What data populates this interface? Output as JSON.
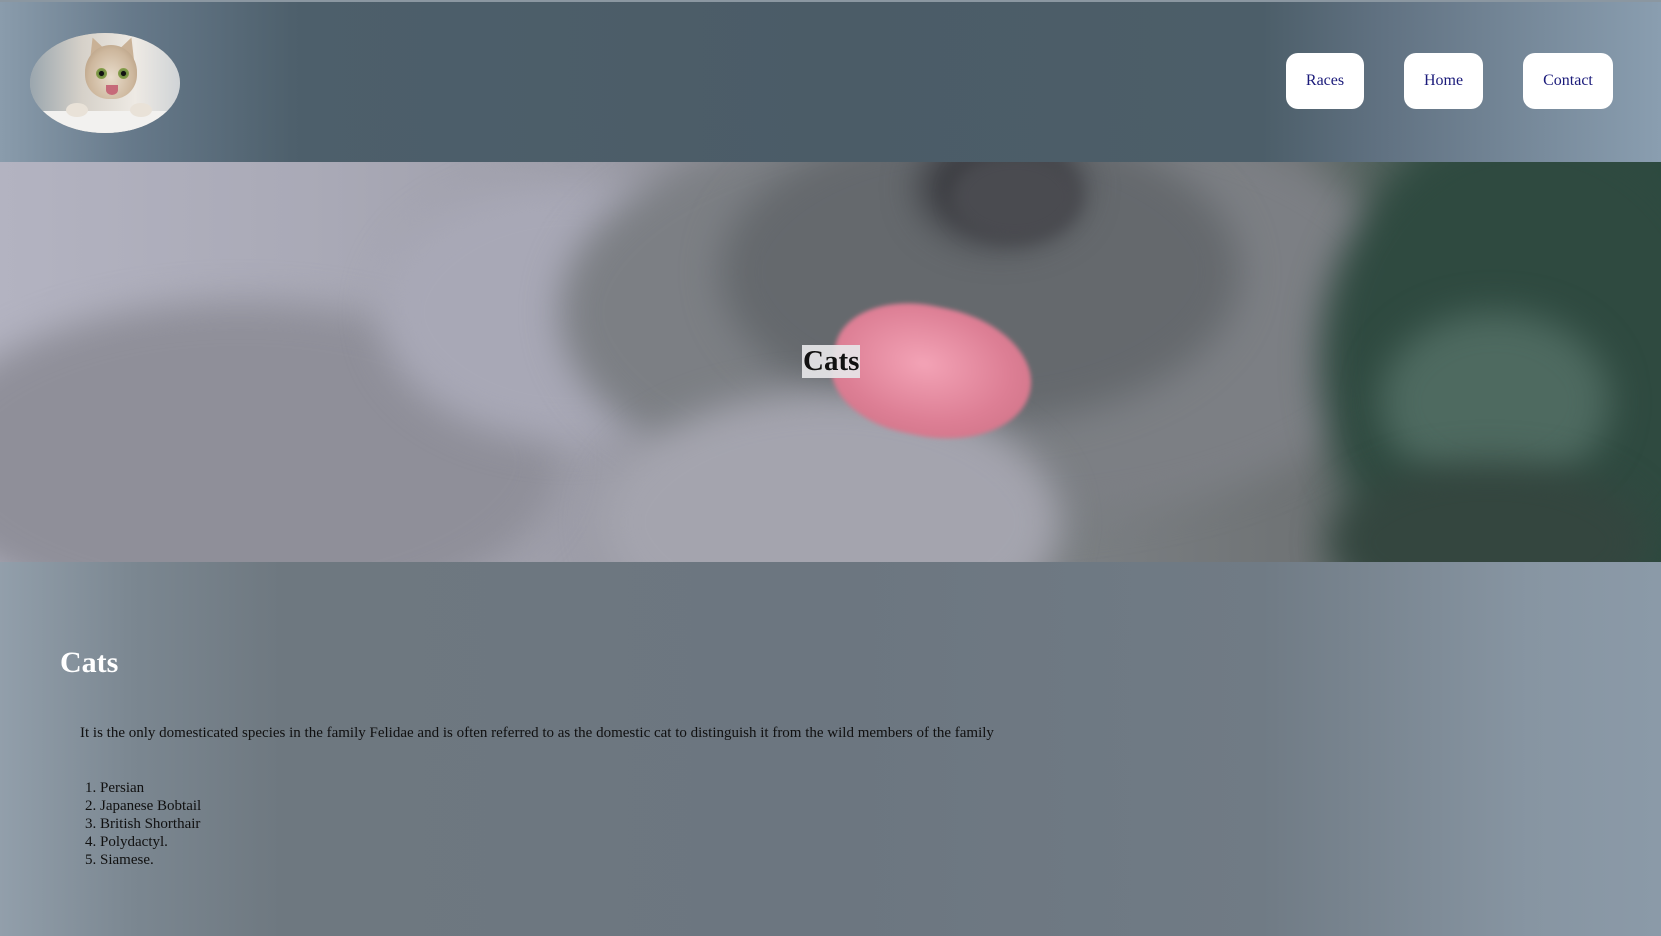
{
  "header": {
    "nav": [
      {
        "label": "Races"
      },
      {
        "label": "Home"
      },
      {
        "label": "Contact"
      }
    ]
  },
  "hero": {
    "title": "Cats"
  },
  "main": {
    "title": "Cats",
    "description": "It is the only domesticated species in the family Felidae and is often referred to as the domestic cat to distinguish it from the wild members of the family",
    "breeds": [
      "Persian",
      "Japanese Bobtail",
      "British Shorthair",
      "Polydactyl.",
      "Siamese."
    ]
  },
  "colors": {
    "header_bg": "#4b5c67",
    "nav_button_bg": "#ffffff",
    "nav_text": "#1a1a7a",
    "content_bg": "#6e7880",
    "heading_text": "#ffffff"
  }
}
